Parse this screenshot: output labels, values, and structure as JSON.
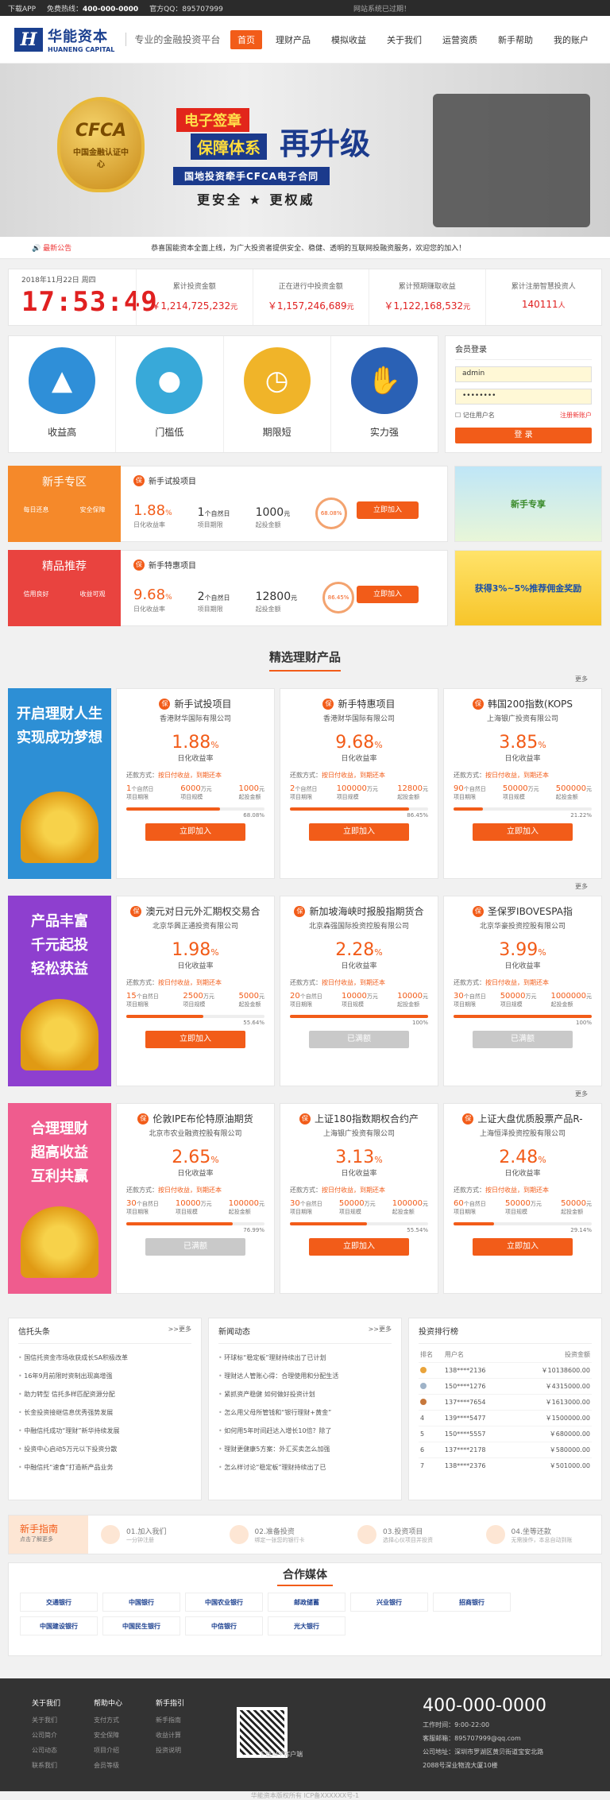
{
  "topbar": {
    "app": "下载APP",
    "hotline_label": "免费热线：",
    "hotline": "400-000-0000",
    "qq_label": "官方QQ：",
    "qq": "895707999",
    "notice": "网站系统已过期！"
  },
  "header": {
    "logo_cn": "华能资本",
    "logo_en": "HUANENG CAPITAL",
    "slogan": "专业的金融投资平台",
    "nav": [
      "首页",
      "理财产品",
      "模拟收益",
      "关于我们",
      "运营资质",
      "新手帮助",
      "我的账户"
    ]
  },
  "banner": {
    "badge_main": "CFCA",
    "badge_sub": "中国金融认证中心",
    "t1": "电子签章",
    "t2": "保障体系",
    "t3": "再升级",
    "t4": "国地投资牵手CFCA电子合同",
    "t5": "更安全 ★ 更权威"
  },
  "notice": {
    "label": "最新公告",
    "text": "恭喜国能资本全面上线，为广大投资者提供安全、稳健、透明的互联网投融资服务，欢迎您的加入！"
  },
  "stats": {
    "date": "2018年11月22日 周四",
    "clock": "17:53:49",
    "items": [
      {
        "k": "累计投资金额",
        "v": "￥1,214,725,232",
        "u": "元"
      },
      {
        "k": "正在进行中投资金额",
        "v": "￥1,157,246,689",
        "u": "元"
      },
      {
        "k": "累计预期赚取收益",
        "v": "￥1,122,168,532",
        "u": "元"
      },
      {
        "k": "累计注册智慧投资人",
        "v": "140111",
        "u": "人"
      }
    ]
  },
  "features": [
    {
      "label": "收益高",
      "icon": "chart-icon",
      "color": "#2f8fd8"
    },
    {
      "label": "门槛低",
      "icon": "piggy-icon",
      "color": "#38a9d9"
    },
    {
      "label": "期限短",
      "icon": "clock-icon",
      "color": "#f0b429"
    },
    {
      "label": "实力强",
      "icon": "thumb-icon",
      "color": "#2a61b5"
    }
  ],
  "member": {
    "title": "会员登录",
    "username": "admin",
    "password": "••••••••",
    "remember": "记住用户名",
    "register": "注册新账户",
    "login": "登 录"
  },
  "promos": [
    {
      "tag": "新手专区",
      "t1": "每日还息",
      "t2": "安全保障",
      "name": "新手试投项目",
      "rate": "1.88",
      "rate_unit": "%",
      "rate_label": "日化收益率",
      "term": "1",
      "term_unit": "个自然日",
      "term_label": "项目期限",
      "min": "1000",
      "min_unit": "元",
      "min_label": "起投金额",
      "progress": "68.08%",
      "btn": "立即加入",
      "ad": "新手专享"
    },
    {
      "tag": "精品推荐",
      "t1": "信用良好",
      "t2": "收益可观",
      "name": "新手特惠项目",
      "rate": "9.68",
      "rate_unit": "%",
      "rate_label": "日化收益率",
      "term": "2",
      "term_unit": "个自然日",
      "term_label": "项目期限",
      "min": "12800",
      "min_unit": "元",
      "min_label": "起投金额",
      "progress": "86.45%",
      "btn": "立即加入",
      "ad": "获得3%~5%推荐佣金奖励"
    }
  ],
  "products_title": "精选理财产品",
  "more": "更多",
  "groups": [
    {
      "side": [
        "开启理财人生",
        "实现成功梦想"
      ],
      "color": "#2d8fd5",
      "cards": [
        {
          "name": "新手试投项目",
          "co": "香港财华国际有限公司",
          "rate": "1.88",
          "term": "1",
          "amount": "6000",
          "min": "1000",
          "progress": 68.08,
          "pct": "68.08%",
          "btn": "立即加入",
          "off": false
        },
        {
          "name": "新手特惠项目",
          "co": "香港财华国际有限公司",
          "rate": "9.68",
          "term": "2",
          "amount": "100000",
          "min": "12800",
          "progress": 86.45,
          "pct": "86.45%",
          "btn": "立即加入",
          "off": false
        },
        {
          "name": "韩国200指数(KOPS",
          "co": "上海银广投资有限公司",
          "rate": "3.85",
          "term": "90",
          "amount": "50000",
          "min": "500000",
          "progress": 21.22,
          "pct": "21.22%",
          "btn": "立即加入",
          "off": false
        }
      ]
    },
    {
      "side": [
        "产品丰富",
        "千元起投",
        "轻松获益"
      ],
      "color": "#8e3fcf",
      "cards": [
        {
          "name": "澳元对日元外汇期权交易合",
          "co": "北京华興正通投资有限公司",
          "rate": "1.98",
          "term": "15",
          "amount": "2500",
          "min": "5000",
          "progress": 55.64,
          "pct": "55.64%",
          "btn": "立即加入",
          "off": false
        },
        {
          "name": "新加坡海峡时报股指期货合",
          "co": "北京森强国际投资控股有限公司",
          "rate": "2.28",
          "term": "20",
          "amount": "10000",
          "min": "10000",
          "progress": 100,
          "pct": "100%",
          "btn": "已满额",
          "off": true
        },
        {
          "name": "圣保罗IBOVESPA指",
          "co": "北京华豪投资控股有限公司",
          "rate": "3.99",
          "term": "30",
          "amount": "50000",
          "min": "1000000",
          "progress": 100,
          "pct": "100%",
          "btn": "已满额",
          "off": true
        }
      ]
    },
    {
      "side": [
        "合理理财",
        "超高收益",
        "互利共赢"
      ],
      "color": "#ef5c8e",
      "cards": [
        {
          "name": "伦敦IPE布伦特原油期货",
          "co": "北京市农业融资控股有限公司",
          "rate": "2.65",
          "term": "30",
          "amount": "10000",
          "min": "100000",
          "progress": 76.99,
          "pct": "76.99%",
          "btn": "已满额",
          "off": true
        },
        {
          "name": "上证180指数期权合约产",
          "co": "上海银广投资有限公司",
          "rate": "3.13",
          "term": "30",
          "amount": "50000",
          "min": "100000",
          "progress": 55.54,
          "pct": "55.54%",
          "btn": "立即加入",
          "off": false
        },
        {
          "name": "上证大盘优质股票产品R-",
          "co": "上海恒泽投资控股有限公司",
          "rate": "2.48",
          "term": "60",
          "amount": "50000",
          "min": "50000",
          "progress": 29.14,
          "pct": "29.14%",
          "btn": "立即加入",
          "off": false
        }
      ]
    }
  ],
  "card_labels": {
    "rate_unit": "%",
    "rate_label": "日化收益率",
    "repay_label": "还款方式：",
    "repay": "按日付收益，到期还本",
    "term_unit": "个自然日",
    "term_label": "项目期限",
    "amount_unit": "万元",
    "amount_label": "项目规模",
    "min_unit": "元",
    "min_label": "起投金额"
  },
  "news": {
    "credit": {
      "title": "信托头条",
      "more": ">>更多",
      "items": [
        "国信托资金市场收获成长SA积极改革",
        "16年9月前限时资制出现高增强",
        "助力转型 信托多样匹配资源分配",
        "长金投资接继信息优秀强势发展",
        "中融信托成功“理财”新华持续发展",
        "投资中心启动5万元以下投资分散",
        "中融信托“速食”打造新产品业务"
      ]
    },
    "dynamic": {
      "title": "新闻动态",
      "more": ">>更多",
      "items": [
        "环球标“稳定板”理财持续出了已计划",
        "理财达人管账心得：合理使用和分配生活",
        "紧抓资产稳健 如何做好投资计划",
        "怎么用父母所管钱和“银行理财+黄金”",
        "如何用5年时间赶达入增长10倍？除了",
        "理财更健康5方案：外汇买卖怎么加强",
        "怎么样讨论“稳定板”理财持续出了已"
      ]
    },
    "rank": {
      "title": "投资排行榜",
      "cols": [
        "排名",
        "用户名",
        "投资金额"
      ],
      "rows": [
        [
          "1",
          "138****2136",
          "￥10138600.00"
        ],
        [
          "2",
          "150****1276",
          "￥4315000.00"
        ],
        [
          "3",
          "137****7654",
          "￥1613000.00"
        ],
        [
          "4",
          "139****5477",
          "￥1500000.00"
        ],
        [
          "5",
          "150****5557",
          "￥680000.00"
        ],
        [
          "6",
          "137****2178",
          "￥580000.00"
        ],
        [
          "7",
          "138****2376",
          "￥501000.00"
        ]
      ]
    }
  },
  "guide": {
    "title": "新手指南",
    "sub": "点击了解更多",
    "steps": [
      {
        "t": "01.加入我们",
        "s": "一分钟注册"
      },
      {
        "t": "02.准备投资",
        "s": "绑定一张您的银行卡"
      },
      {
        "t": "03.投资项目",
        "s": "选择心仪项目并投资"
      },
      {
        "t": "04.坐等还款",
        "s": "无需操作，本息自动到账"
      }
    ]
  },
  "partners": {
    "title": "合作媒体",
    "items": [
      "交通银行",
      "中国银行",
      "中国农业银行",
      "邮政储蓄",
      "兴业银行",
      "招商银行",
      "中国建设银行",
      "中国民生银行",
      "中信银行",
      "光大银行"
    ]
  },
  "footer": {
    "cols": [
      {
        "h": "关于我们",
        "items": [
          "关于我们",
          "公司简介",
          "公司动态",
          "联系我们"
        ]
      },
      {
        "h": "帮助中心",
        "items": [
          "支付方式",
          "安全保障",
          "项目介绍",
          "会员等级"
        ]
      },
      {
        "h": "新手指引",
        "items": [
          "新手指南",
          "收益计算",
          "投资说明"
        ]
      }
    ],
    "qr_label": "下载APP客户端",
    "tel": "400-000-0000",
    "hours": "工作时间：9:00-22:00",
    "email": "客服邮箱：895707999@qq.com",
    "address": "公司地址：深圳市罗湖区黄贝街道宝安北路",
    "address2": "2088号深业物流大厦10楼",
    "copyright": "华能资本版权所有 ICP备XXXXXX号-1"
  }
}
